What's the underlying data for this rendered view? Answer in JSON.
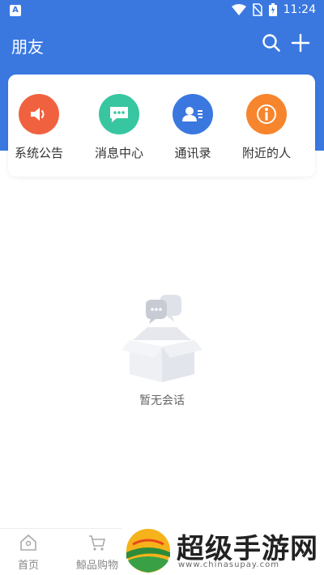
{
  "status_bar": {
    "time": "11:24"
  },
  "header": {
    "title": "朋友"
  },
  "quick_menu": [
    {
      "label": "系统公告",
      "icon": "speaker-icon",
      "color": "#f0623f"
    },
    {
      "label": "消息中心",
      "icon": "chat-bubble-icon",
      "color": "#38c6a0"
    },
    {
      "label": "通讯录",
      "icon": "contacts-icon",
      "color": "#3a78e0"
    },
    {
      "label": "附近的人",
      "icon": "location-info-icon",
      "color": "#f7852e"
    }
  ],
  "empty_state": {
    "text": "暂无会话"
  },
  "bottom_nav": [
    {
      "label": "首页",
      "icon": "home-icon"
    },
    {
      "label": "鯨品购物",
      "icon": "cart-icon"
    }
  ],
  "watermark": {
    "title": "超级手游网",
    "url": "www.chinasupay.com"
  },
  "colors": {
    "primary": "#3a78e0",
    "background": "#ffffff"
  }
}
